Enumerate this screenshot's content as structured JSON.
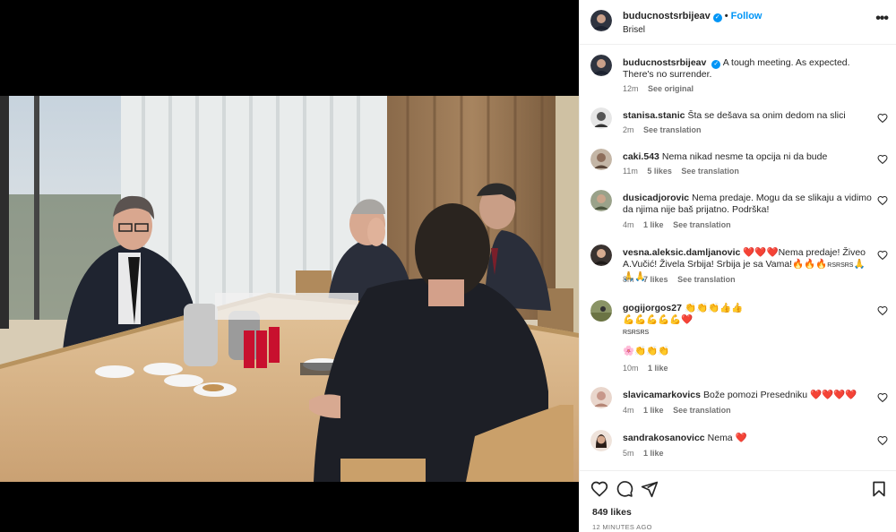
{
  "post": {
    "username": "buducnostsrbijeav",
    "follow_label": "Follow",
    "separator": "•",
    "location": "Brisel",
    "more_label": "•••"
  },
  "caption": {
    "username": "buducnostsrbijeav",
    "text": "A tough meeting. As expected. There's no surrender.",
    "time": "12m",
    "see_original": "See original"
  },
  "comments": [
    {
      "username": "stanisa.stanic",
      "text": "Šta se dešava sa onim dedom na slici",
      "time": "2m",
      "likes": "",
      "translate": "See translation"
    },
    {
      "username": "caki.543",
      "text": "Nema nikad nesme ta opcija ni da bude",
      "time": "11m",
      "likes": "5 likes",
      "translate": "See translation"
    },
    {
      "username": "dusicadjorovic",
      "text": "Nema predaje. Mogu da se slikaju a vidimo da njima nije baš prijatno. Podrška!",
      "time": "4m",
      "likes": "1 like",
      "translate": "See translation"
    },
    {
      "username": "vesna.aleksic.damljanovic",
      "text_a": "❤️❤️❤️",
      "text_b": "Nema predaje! Živeo A.Vučić! Živela Srbija! Srbija je sa Vama!🔥🔥🔥",
      "text_c": "RSRSRS",
      "text_d": "🙏🙏🙏",
      "time": "8m",
      "likes": "7 likes",
      "translate": "See translation"
    },
    {
      "username": "gogijorgos27",
      "text_a": "👏👏👏👍👍",
      "text_b": "💪💪💪💪💪❤️",
      "text_c": "RSRSRS",
      "text_d": "🌸👏👏👏",
      "time": "10m",
      "likes": "1 like",
      "translate": ""
    },
    {
      "username": "slavicamarkovics",
      "text": "Bože pomozi Presedniku",
      "hearts": "❤️❤️❤️❤️",
      "time": "4m",
      "likes": "1 like",
      "translate": "See translation"
    },
    {
      "username": "sandrakosanovicc",
      "text": "Nema",
      "hearts": "❤️",
      "time": "5m",
      "likes": "1 like",
      "translate": ""
    }
  ],
  "footer": {
    "likes": "849 likes",
    "timestamp": "12 MINUTES AGO"
  },
  "icons": {
    "like": "heart-icon",
    "comment": "comment-icon",
    "share": "share-icon",
    "save": "bookmark-icon"
  },
  "colors": {
    "accent": "#0095f6",
    "heart": "#ed4956",
    "meta_text": "#737373"
  }
}
